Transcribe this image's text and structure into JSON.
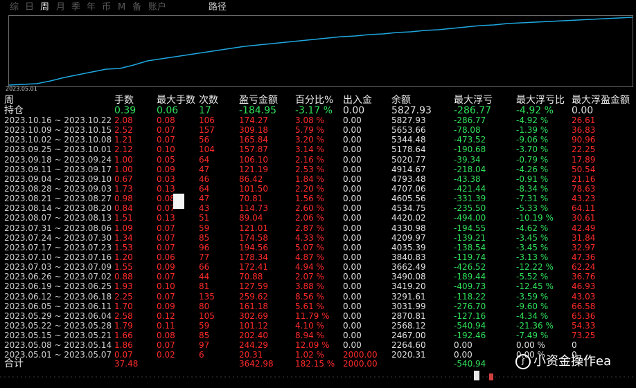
{
  "tabs": [
    {
      "label": "综",
      "active": false
    },
    {
      "label": "日",
      "active": false
    },
    {
      "label": "周",
      "active": true
    },
    {
      "label": "月",
      "active": false
    },
    {
      "label": "季",
      "active": false
    },
    {
      "label": "年",
      "active": false
    },
    {
      "label": "币",
      "active": false
    },
    {
      "label": "M",
      "active": false
    },
    {
      "label": "备",
      "active": false
    },
    {
      "label": "账户",
      "active": false
    }
  ],
  "path_tab": "路径",
  "chart": {
    "start_label": "2023.05.01",
    "line_color": "#1fa8e0"
  },
  "headers": {
    "period": "周",
    "lots": "手数",
    "max_lots": "最大手数",
    "trades": "次数",
    "pnl": "盈亏金额",
    "percent": "百分比%",
    "deposit": "出入金",
    "balance": "余额",
    "max_float_loss": "最大浮亏",
    "max_float_loss_pct": "最大浮亏比",
    "max_float_profit": "最大浮盈金额"
  },
  "holding": {
    "label": "持仓",
    "lots": "0.39",
    "max_lots": "0.06",
    "trades": "17",
    "pnl": "-184.95",
    "percent": "-3.17 %",
    "deposit": "0.00",
    "balance": "5827.93",
    "max_float_loss": "-286.77",
    "max_float_loss_pct": "-4.92 %",
    "max_float_profit": "0.00"
  },
  "rows": [
    {
      "period": "2023.10.16 ~ 2023.10.22",
      "lots": "2.08",
      "max_lots": "0.08",
      "trades": "106",
      "pnl": "174.27",
      "percent": "3.08 %",
      "deposit": "0.00",
      "balance": "5827.93",
      "mfl": "-286.77",
      "mflp": "-4.92 %",
      "mfp": "26.61"
    },
    {
      "period": "2023.10.09 ~ 2023.10.15",
      "lots": "2.52",
      "max_lots": "0.07",
      "trades": "157",
      "pnl": "309.18",
      "percent": "5.79 %",
      "deposit": "0.00",
      "balance": "5653.66",
      "mfl": "-78.08",
      "mflp": "-1.39 %",
      "mfp": "36.83"
    },
    {
      "period": "2023.10.02 ~ 2023.10.08",
      "lots": "1.21",
      "max_lots": "0.07",
      "trades": "56",
      "pnl": "165.84",
      "percent": "3.20 %",
      "deposit": "0.00",
      "balance": "5344.48",
      "mfl": "-473.52",
      "mflp": "-9.06 %",
      "mfp": "90.96"
    },
    {
      "period": "2023.09.25 ~ 2023.10.01",
      "lots": "2.12",
      "max_lots": "0.10",
      "trades": "104",
      "pnl": "157.87",
      "percent": "3.14 %",
      "deposit": "0.00",
      "balance": "5178.64",
      "mfl": "-190.68",
      "mflp": "-3.70 %",
      "mfp": "22.25"
    },
    {
      "period": "2023.09.18 ~ 2023.09.24",
      "lots": "1.00",
      "max_lots": "0.05",
      "trades": "64",
      "pnl": "106.10",
      "percent": "2.16 %",
      "deposit": "0.00",
      "balance": "5020.77",
      "mfl": "-39.34",
      "mflp": "-0.79 %",
      "mfp": "17.89"
    },
    {
      "period": "2023.09.11 ~ 2023.09.17",
      "lots": "1.00",
      "max_lots": "0.09",
      "trades": "47",
      "pnl": "121.19",
      "percent": "2.53 %",
      "deposit": "0.00",
      "balance": "4914.67",
      "mfl": "-218.04",
      "mflp": "-4.26 %",
      "mfp": "50.54"
    },
    {
      "period": "2023.09.04 ~ 2023.09.10",
      "lots": "0.67",
      "max_lots": "0.03",
      "trades": "46",
      "pnl": "86.42",
      "percent": "1.84 %",
      "deposit": "0.00",
      "balance": "4793.48",
      "mfl": "-43.38",
      "mflp": "-0.91 %",
      "mfp": "21.16"
    },
    {
      "period": "2023.08.28 ~ 2023.09.03",
      "lots": "1.73",
      "max_lots": "0.13",
      "trades": "64",
      "pnl": "101.50",
      "percent": "2.20 %",
      "deposit": "0.00",
      "balance": "4707.06",
      "mfl": "-421.44",
      "mflp": "-8.34 %",
      "mfp": "78.63"
    },
    {
      "period": "2023.08.21 ~ 2023.08.27",
      "lots": "0.98",
      "max_lots": "0.08",
      "trades": "47",
      "pnl": "70.81",
      "percent": "1.56 %",
      "deposit": "0.00",
      "balance": "4605.56",
      "mfl": "-331.39",
      "mflp": "-7.31 %",
      "mfp": "43.23"
    },
    {
      "period": "2023.08.14 ~ 2023.08.20",
      "lots": "0.84",
      "max_lots": "0.07",
      "trades": "43",
      "pnl": "114.73",
      "percent": "2.60 %",
      "deposit": "0.00",
      "balance": "4534.75",
      "mfl": "-235.50",
      "mflp": "-5.33 %",
      "mfp": "64.11"
    },
    {
      "period": "2023.08.07 ~ 2023.08.13",
      "lots": "1.51",
      "max_lots": "0.13",
      "trades": "51",
      "pnl": "89.04",
      "percent": "2.06 %",
      "deposit": "0.00",
      "balance": "4420.02",
      "mfl": "-494.00",
      "mflp": "-10.19 %",
      "mfp": "30.61"
    },
    {
      "period": "2023.07.31 ~ 2023.08.06",
      "lots": "1.09",
      "max_lots": "0.07",
      "trades": "59",
      "pnl": "121.01",
      "percent": "2.87 %",
      "deposit": "0.00",
      "balance": "4330.98",
      "mfl": "-194.55",
      "mflp": "-4.62 %",
      "mfp": "42.49"
    },
    {
      "period": "2023.07.24 ~ 2023.07.30",
      "lots": "1.34",
      "max_lots": "0.07",
      "trades": "85",
      "pnl": "174.58",
      "percent": "4.33 %",
      "deposit": "0.00",
      "balance": "4209.97",
      "mfl": "-139.21",
      "mflp": "-3.45 %",
      "mfp": "31.84"
    },
    {
      "period": "2023.07.17 ~ 2023.07.23",
      "lots": "1.53",
      "max_lots": "0.07",
      "trades": "96",
      "pnl": "194.56",
      "percent": "5.07 %",
      "deposit": "0.00",
      "balance": "4035.39",
      "mfl": "-138.54",
      "mflp": "-3.45 %",
      "mfp": "32.97"
    },
    {
      "period": "2023.07.10 ~ 2023.07.16",
      "lots": "1.20",
      "max_lots": "0.06",
      "trades": "77",
      "pnl": "178.34",
      "percent": "4.87 %",
      "deposit": "0.00",
      "balance": "3840.83",
      "mfl": "-119.74",
      "mflp": "-3.13 %",
      "mfp": "47.36"
    },
    {
      "period": "2023.07.03 ~ 2023.07.09",
      "lots": "1.55",
      "max_lots": "0.09",
      "trades": "66",
      "pnl": "172.41",
      "percent": "4.94 %",
      "deposit": "0.00",
      "balance": "3662.49",
      "mfl": "-426.52",
      "mflp": "-12.22 %",
      "mfp": "62.24"
    },
    {
      "period": "2023.06.26 ~ 2023.07.02",
      "lots": "0.88",
      "max_lots": "0.07",
      "trades": "44",
      "pnl": "70.88",
      "percent": "2.07 %",
      "deposit": "0.00",
      "balance": "3490.08",
      "mfl": "-189.44",
      "mflp": "-5.52 %",
      "mfp": "36.76"
    },
    {
      "period": "2023.06.19 ~ 2023.06.25",
      "lots": "1.93",
      "max_lots": "0.10",
      "trades": "81",
      "pnl": "127.59",
      "percent": "3.88 %",
      "deposit": "0.00",
      "balance": "3419.20",
      "mfl": "-409.73",
      "mflp": "-12.45 %",
      "mfp": "46.93"
    },
    {
      "period": "2023.06.12 ~ 2023.06.18",
      "lots": "2.25",
      "max_lots": "0.07",
      "trades": "135",
      "pnl": "259.62",
      "percent": "8.56 %",
      "deposit": "0.00",
      "balance": "3291.61",
      "mfl": "-118.22",
      "mflp": "-3.59 %",
      "mfp": "43.03"
    },
    {
      "period": "2023.06.05 ~ 2023.06.11",
      "lots": "1.70",
      "max_lots": "0.09",
      "trades": "80",
      "pnl": "161.18",
      "percent": "5.61 %",
      "deposit": "0.00",
      "balance": "3031.99",
      "mfl": "-276.70",
      "mflp": "-9.60 %",
      "mfp": "66.58"
    },
    {
      "period": "2023.05.29 ~ 2023.06.04",
      "lots": "2.58",
      "max_lots": "0.12",
      "trades": "105",
      "pnl": "302.69",
      "percent": "11.79 %",
      "deposit": "0.00",
      "balance": "2870.81",
      "mfl": "-127.16",
      "mflp": "-4.34 %",
      "mfp": "65.36"
    },
    {
      "period": "2023.05.22 ~ 2023.05.28",
      "lots": "1.79",
      "max_lots": "0.11",
      "trades": "59",
      "pnl": "101.12",
      "percent": "4.10 %",
      "deposit": "0.00",
      "balance": "2568.12",
      "mfl": "-540.94",
      "mflp": "-21.36 %",
      "mfp": "54.33"
    },
    {
      "period": "2023.05.15 ~ 2023.05.21",
      "lots": "1.66",
      "max_lots": "0.08",
      "trades": "85",
      "pnl": "202.40",
      "percent": "8.94 %",
      "deposit": "0.00",
      "balance": "2467.00",
      "mfl": "-192.46",
      "mflp": "-7.49 %",
      "mfp": "73.25"
    },
    {
      "period": "2023.05.08 ~ 2023.05.14",
      "lots": "1.86",
      "max_lots": "0.07",
      "trades": "97",
      "pnl": "244.29",
      "percent": "12.09 %",
      "deposit": "0.00",
      "balance": "2264.60",
      "mfl": "0.00",
      "mflp": "0.00 %",
      "mfp": "0"
    },
    {
      "period": "2023.05.01 ~ 2023.05.07",
      "lots": "0.07",
      "max_lots": "0.02",
      "trades": "6",
      "pnl": "20.31",
      "percent": "1.02 %",
      "deposit": "2000.00",
      "balance": "2020.31",
      "mfl": "0.00",
      "mflp": "0.00 %",
      "mfp": "0"
    }
  ],
  "total": {
    "label": "合计",
    "lots": "37.48",
    "pnl": "3642.98",
    "percent": "182.15 %",
    "deposit": "2000.00",
    "mfl": "-540.94"
  },
  "watermark": "小资金操作ea",
  "colors": {
    "positive": "#ff2a2a",
    "negative": "#2fe05a",
    "neutral": "#e0e0e0",
    "line": "#1fa8e0"
  }
}
